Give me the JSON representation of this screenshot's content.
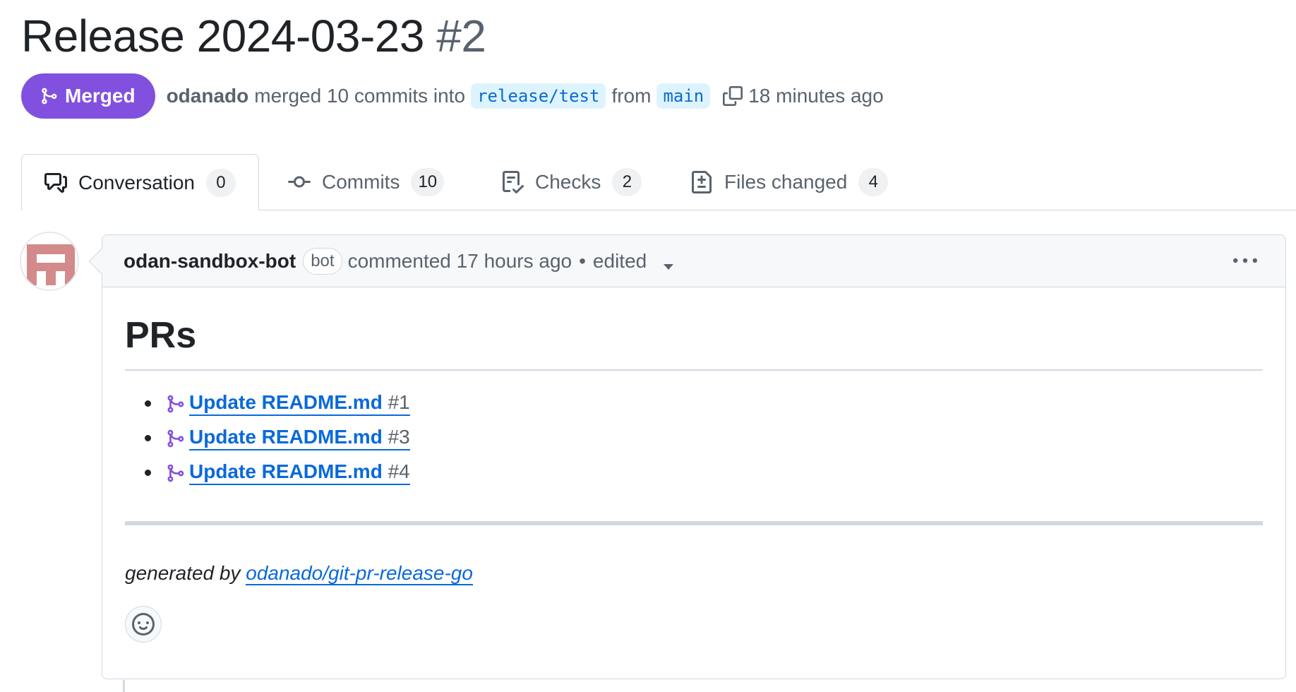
{
  "title": {
    "text": "Release 2024-03-23",
    "number": "#2"
  },
  "status": {
    "badge_label": "Merged",
    "author": "odanado",
    "action": "merged 10 commits into",
    "base_branch": "release/test",
    "from_word": "from",
    "head_branch": "main",
    "time": "18 minutes ago"
  },
  "tabs": [
    {
      "label": "Conversation",
      "count": "0",
      "icon": "comment-discussion-icon",
      "active": true
    },
    {
      "label": "Commits",
      "count": "10",
      "icon": "commit-icon"
    },
    {
      "label": "Checks",
      "count": "2",
      "icon": "checklist-icon"
    },
    {
      "label": "Files changed",
      "count": "4",
      "icon": "file-diff-icon"
    }
  ],
  "comment": {
    "author": "odan-sandbox-bot",
    "bot_label": "bot",
    "meta": "commented 17 hours ago",
    "separator": "•",
    "edited": "edited",
    "heading": "PRs",
    "items": [
      {
        "title": "Update README.md",
        "number": "#1"
      },
      {
        "title": "Update README.md",
        "number": "#3"
      },
      {
        "title": "Update README.md",
        "number": "#4"
      }
    ],
    "footer_prefix": "generated by",
    "footer_link": "odanado/git-pr-release-go"
  },
  "colors": {
    "merged": "#8250df",
    "link": "#0969da",
    "muted": "#59636e",
    "border": "#d1d9e0"
  }
}
